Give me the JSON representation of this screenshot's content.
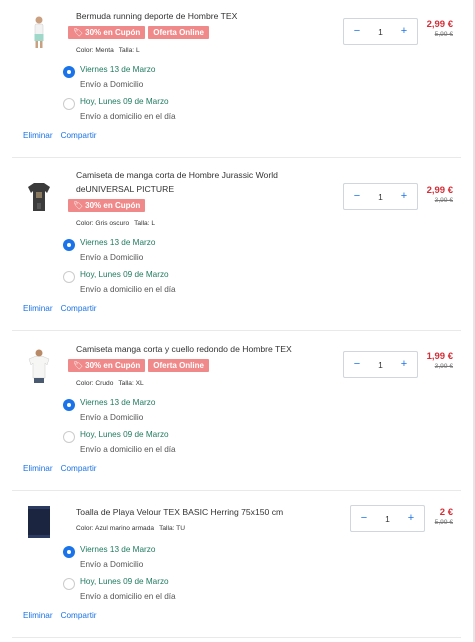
{
  "colors": {
    "accent": "#1a73e8",
    "price": "#d42e36",
    "badge": "#f08a8a",
    "date": "#1f7a5f"
  },
  "items": [
    {
      "title": "Bermuda running deporte de Hombre TEX",
      "badges": [
        {
          "icon": "coupon-tag-icon",
          "text": "30% en Cupón"
        },
        {
          "text": "Oferta Online"
        }
      ],
      "color": "Color: Menta",
      "size": "Talla: L",
      "delivery": [
        {
          "selected": true,
          "date": "Viernes 13 de Marzo",
          "method": "Envío a Domicilio"
        },
        {
          "selected": false,
          "date": "Hoy, Lunes 09 de Marzo",
          "method": "Envío a domicilio en el día"
        }
      ],
      "quantity": "1",
      "price": "2,99 €",
      "old_price": "5,99 €"
    },
    {
      "title": "Camiseta de manga corta de Hombre Jurassic World deUNIVERSAL PICTURE",
      "badges": [
        {
          "icon": "coupon-tag-icon",
          "text": "30% en Cupón"
        }
      ],
      "color": "Color: Gris oscuro",
      "size": "Talla: L",
      "delivery": [
        {
          "selected": true,
          "date": "Viernes 13 de Marzo",
          "method": "Envío a Domicilio"
        },
        {
          "selected": false,
          "date": "Hoy, Lunes 09 de Marzo",
          "method": "Envío a domicilio en el día"
        }
      ],
      "quantity": "1",
      "price": "2,99 €",
      "old_price": "3,99 €"
    },
    {
      "title": "Camiseta manga corta y cuello redondo de Hombre TEX",
      "badges": [
        {
          "icon": "coupon-tag-icon",
          "text": "30% en Cupón"
        },
        {
          "text": "Oferta Online"
        }
      ],
      "color": "Color: Crudo",
      "size": "Talla: XL",
      "delivery": [
        {
          "selected": true,
          "date": "Viernes 13 de Marzo",
          "method": "Envío a Domicilio"
        },
        {
          "selected": false,
          "date": "Hoy, Lunes 09 de Marzo",
          "method": "Envío a domicilio en el día"
        }
      ],
      "quantity": "1",
      "price": "1,99 €",
      "old_price": "3,99 €"
    },
    {
      "title": "Toalla de Playa Velour TEX BASIC Herring 75x150 cm",
      "badges": [],
      "color": "Color: Azul marino armada",
      "size": "Talla: TU",
      "delivery": [
        {
          "selected": true,
          "date": "Viernes 13 de Marzo",
          "method": "Envío a Domicilio"
        },
        {
          "selected": false,
          "date": "Hoy, Lunes 09 de Marzo",
          "method": "Envío a domicilio en el día"
        }
      ],
      "quantity": "1",
      "price": "2 €",
      "old_price": "5,99 €"
    }
  ],
  "actions": {
    "remove": "Eliminar",
    "share": "Compartir"
  },
  "stepper": {
    "minus": "−",
    "plus": "+"
  }
}
